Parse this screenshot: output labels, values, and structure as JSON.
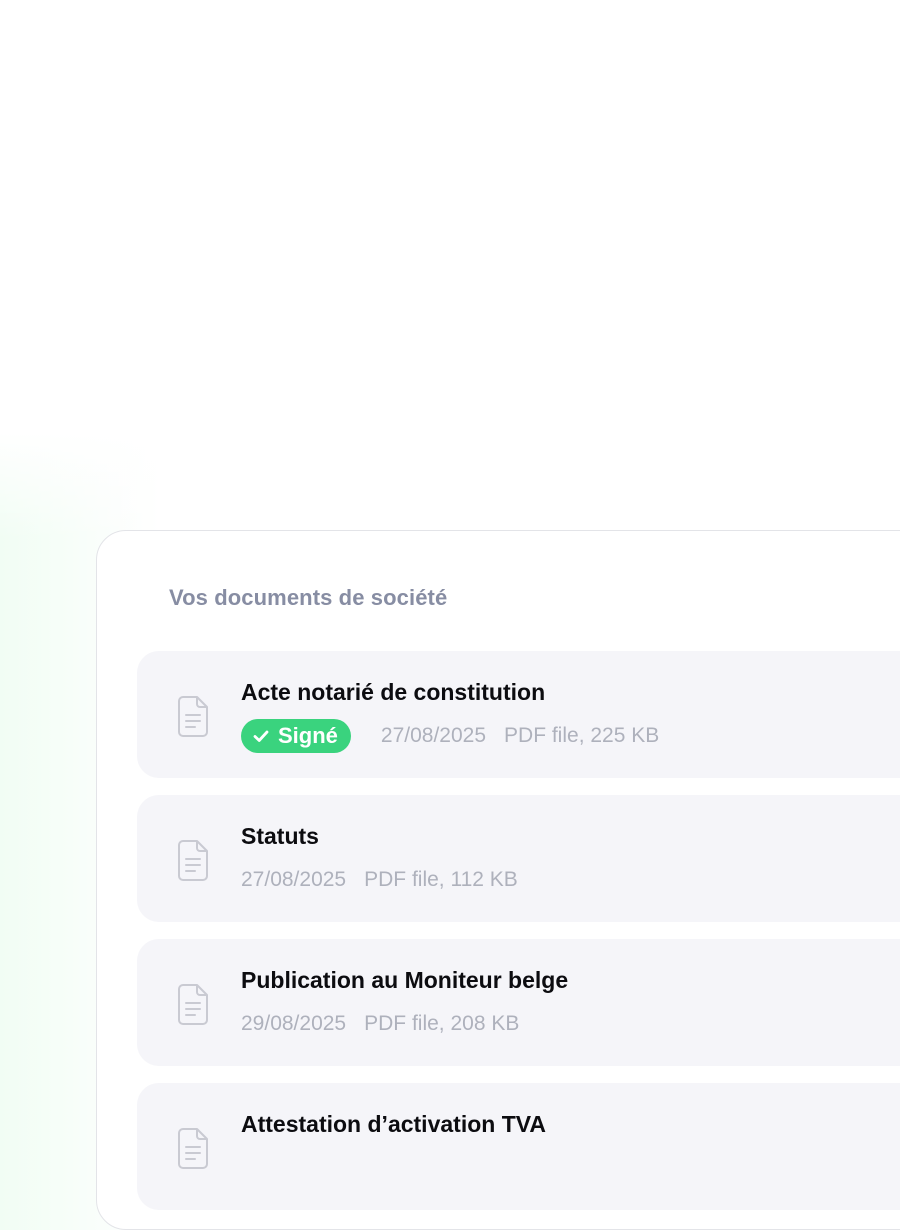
{
  "card": {
    "title": "Vos documents de société"
  },
  "documents": [
    {
      "name": "Acte notarié de constitution",
      "status": "Signé",
      "date": "27/08/2025",
      "file_info": "PDF file, 225 KB"
    },
    {
      "name": "Statuts",
      "date": "27/08/2025",
      "file_info": "PDF file, 112 KB"
    },
    {
      "name": "Publication au Moniteur belge",
      "date": "29/08/2025",
      "file_info": "PDF file, 208 KB"
    },
    {
      "name": "Attestation d’activation TVA",
      "date": "",
      "file_info": ""
    }
  ],
  "icons": {
    "document": "document-icon",
    "check": "check-icon"
  },
  "colors": {
    "badge_bg": "#3ad37e",
    "title": "#878da3",
    "item_bg": "#f5f5f9",
    "meta_text": "#aeb1bc"
  }
}
